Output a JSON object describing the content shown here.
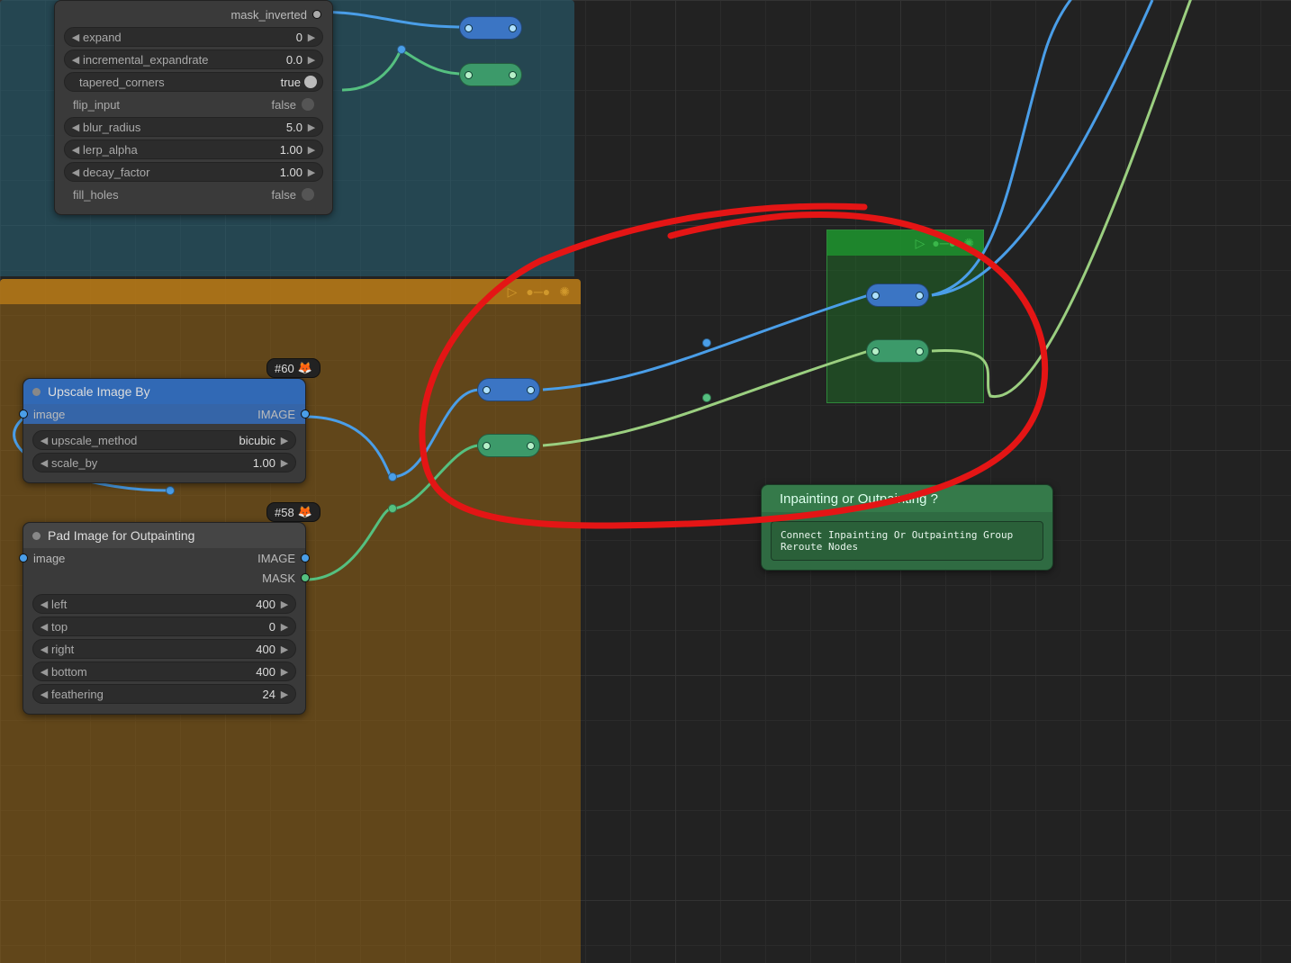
{
  "top_node": {
    "inputs": {
      "mask_inverted": "mask_inverted"
    },
    "widgets": {
      "expand": {
        "label": "expand",
        "value": "0"
      },
      "incremental_expandrate": {
        "label": "incremental_expandrate",
        "value": "0.0"
      },
      "tapered_corners": {
        "label": "tapered_corners",
        "value": "true"
      },
      "flip_input": {
        "label": "flip_input",
        "value": "false"
      },
      "blur_radius": {
        "label": "blur_radius",
        "value": "5.0"
      },
      "lerp_alpha": {
        "label": "lerp_alpha",
        "value": "1.00"
      },
      "decay_factor": {
        "label": "decay_factor",
        "value": "1.00"
      },
      "fill_holes": {
        "label": "fill_holes",
        "value": "false"
      }
    }
  },
  "upscale_node": {
    "title": "Upscale Image By",
    "input": "image",
    "output": "IMAGE",
    "widgets": {
      "upscale_method": {
        "label": "upscale_method",
        "value": "bicubic"
      },
      "scale_by": {
        "label": "scale_by",
        "value": "1.00"
      }
    }
  },
  "pad_node": {
    "title": "Pad Image for Outpainting",
    "input": "image",
    "outputs": {
      "image": "IMAGE",
      "mask": "MASK"
    },
    "widgets": {
      "left": {
        "label": "left",
        "value": "400"
      },
      "top": {
        "label": "top",
        "value": "0"
      },
      "right": {
        "label": "right",
        "value": "400"
      },
      "bottom": {
        "label": "bottom",
        "value": "400"
      },
      "feathering": {
        "label": "feathering",
        "value": "24"
      }
    }
  },
  "note_node": {
    "title": "Inpainting or Outpainting ?",
    "text": "Connect Inpainting Or Outpainting Group Reroute Nodes"
  },
  "tags": {
    "a": "#60",
    "b": "#58"
  }
}
